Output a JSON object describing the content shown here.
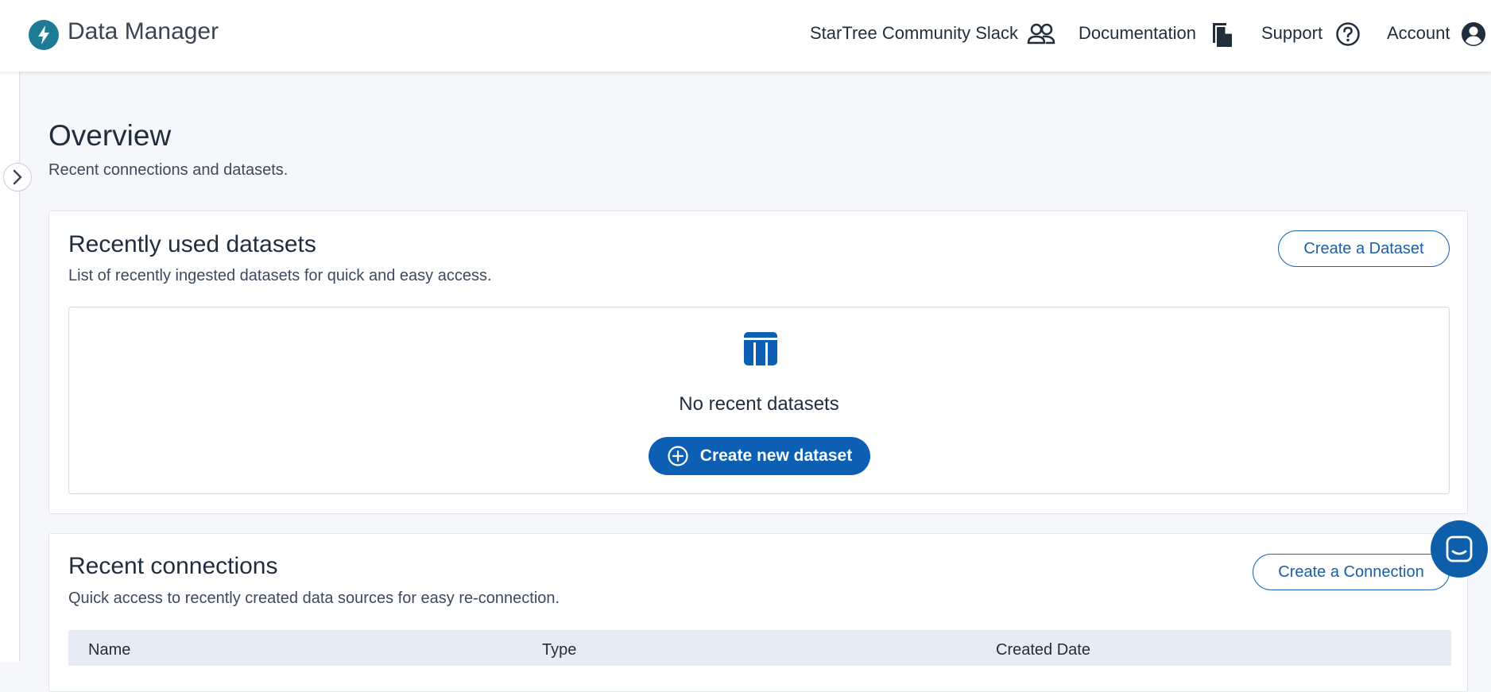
{
  "header": {
    "app_title": "Data Manager",
    "nav": [
      {
        "label": "StarTree Community Slack",
        "icon": "people-icon"
      },
      {
        "label": "Documentation",
        "icon": "document-icon"
      },
      {
        "label": "Support",
        "icon": "help-circle-icon"
      },
      {
        "label": "Account",
        "icon": "account-circle-icon"
      }
    ]
  },
  "page": {
    "title": "Overview",
    "subtitle": "Recent connections and datasets."
  },
  "datasets_card": {
    "title": "Recently used datasets",
    "description": "List of recently ingested datasets for quick and easy access.",
    "create_button": "Create a Dataset",
    "empty_text": "No recent datasets",
    "empty_action": "Create new dataset"
  },
  "connections_card": {
    "title": "Recent connections",
    "description": "Quick access to recently created data sources for easy re-connection.",
    "create_button": "Create a Connection",
    "columns": [
      "Name",
      "Type",
      "Created Date"
    ]
  },
  "colors": {
    "primary": "#0c5fb3",
    "logo": "#1f7a96",
    "table_header": "#e6ebf5"
  }
}
